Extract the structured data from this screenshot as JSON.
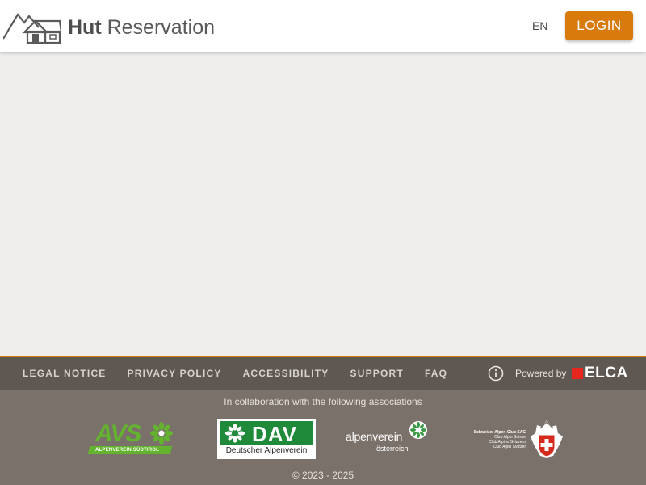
{
  "header": {
    "logo_bold": "Hut",
    "logo_rest": " Reservation",
    "language": "EN",
    "login_label": "LOGIN"
  },
  "footer": {
    "links": [
      "LEGAL NOTICE",
      "PRIVACY POLICY",
      "ACCESSIBILITY",
      "SUPPORT",
      "FAQ"
    ],
    "powered_by": "Powered by",
    "powered_brand": "ELCA",
    "collaboration_text": "In collaboration with the following associations",
    "copyright": "© 2023 - 2025",
    "associations": {
      "avs": {
        "letters": "AVS",
        "band": "ALPENVEREIN SÜDTIROL"
      },
      "dav": {
        "letters": "DAV",
        "subtitle": "Deutscher Alpenverein"
      },
      "oe": {
        "name": "alpenverein",
        "subtitle": "österreich"
      },
      "sac": {
        "lines": [
          "Schweizer Alpen-Club SAC",
          "Club Alpin Suisse",
          "Club Alpino Svizzero",
          "Club Alpin Svizzer"
        ]
      }
    }
  },
  "colors": {
    "accent": "#d97a0c",
    "footer_bar": "#5e5752",
    "footer_lower": "#7b716b",
    "main_bg": "#efeeed",
    "elca_red": "#e6261f",
    "avs_green": "#63b32e",
    "dav_green": "#1f8a3a"
  },
  "icons": {
    "logo": "mountain-hut-icon",
    "info": "info-icon"
  }
}
